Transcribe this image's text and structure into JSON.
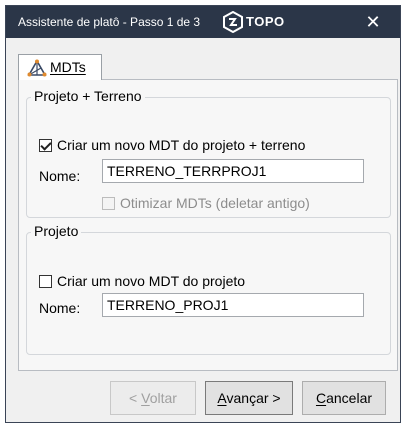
{
  "window": {
    "title": "Assistente de platô  -  Passo 1 de 3",
    "brand_name": "TOPO",
    "close_glyph": "✕",
    "colors": {
      "titlebar": "#2b3648",
      "titlebar_text": "#ffffff"
    }
  },
  "tabs": [
    {
      "label": "MDTs",
      "icon": "mdt-triangle-icon",
      "selected": true
    }
  ],
  "group_projeto_terreno": {
    "title": "Projeto + Terreno",
    "create_checkbox": {
      "label": "Criar um novo MDT do projeto + terreno",
      "checked": true
    },
    "name_label": "Nome:",
    "name_value": "TERRENO_TERRPROJ1",
    "optimize_checkbox": {
      "label": "Otimizar MDTs (deletar antigo)",
      "checked": false,
      "enabled": false
    }
  },
  "group_projeto": {
    "title": "Projeto",
    "create_checkbox": {
      "label": "Criar um novo MDT do projeto",
      "checked": false
    },
    "name_label": "Nome:",
    "name_value": "TERRENO_PROJ1"
  },
  "buttons": {
    "back": {
      "prefix": "< ",
      "mnemonic": "V",
      "rest": "oltar",
      "enabled": false
    },
    "next": {
      "mnemonic": "A",
      "rest": "vançar >",
      "enabled": true
    },
    "cancel": {
      "mnemonic": "C",
      "rest": "ancelar",
      "enabled": true
    }
  }
}
